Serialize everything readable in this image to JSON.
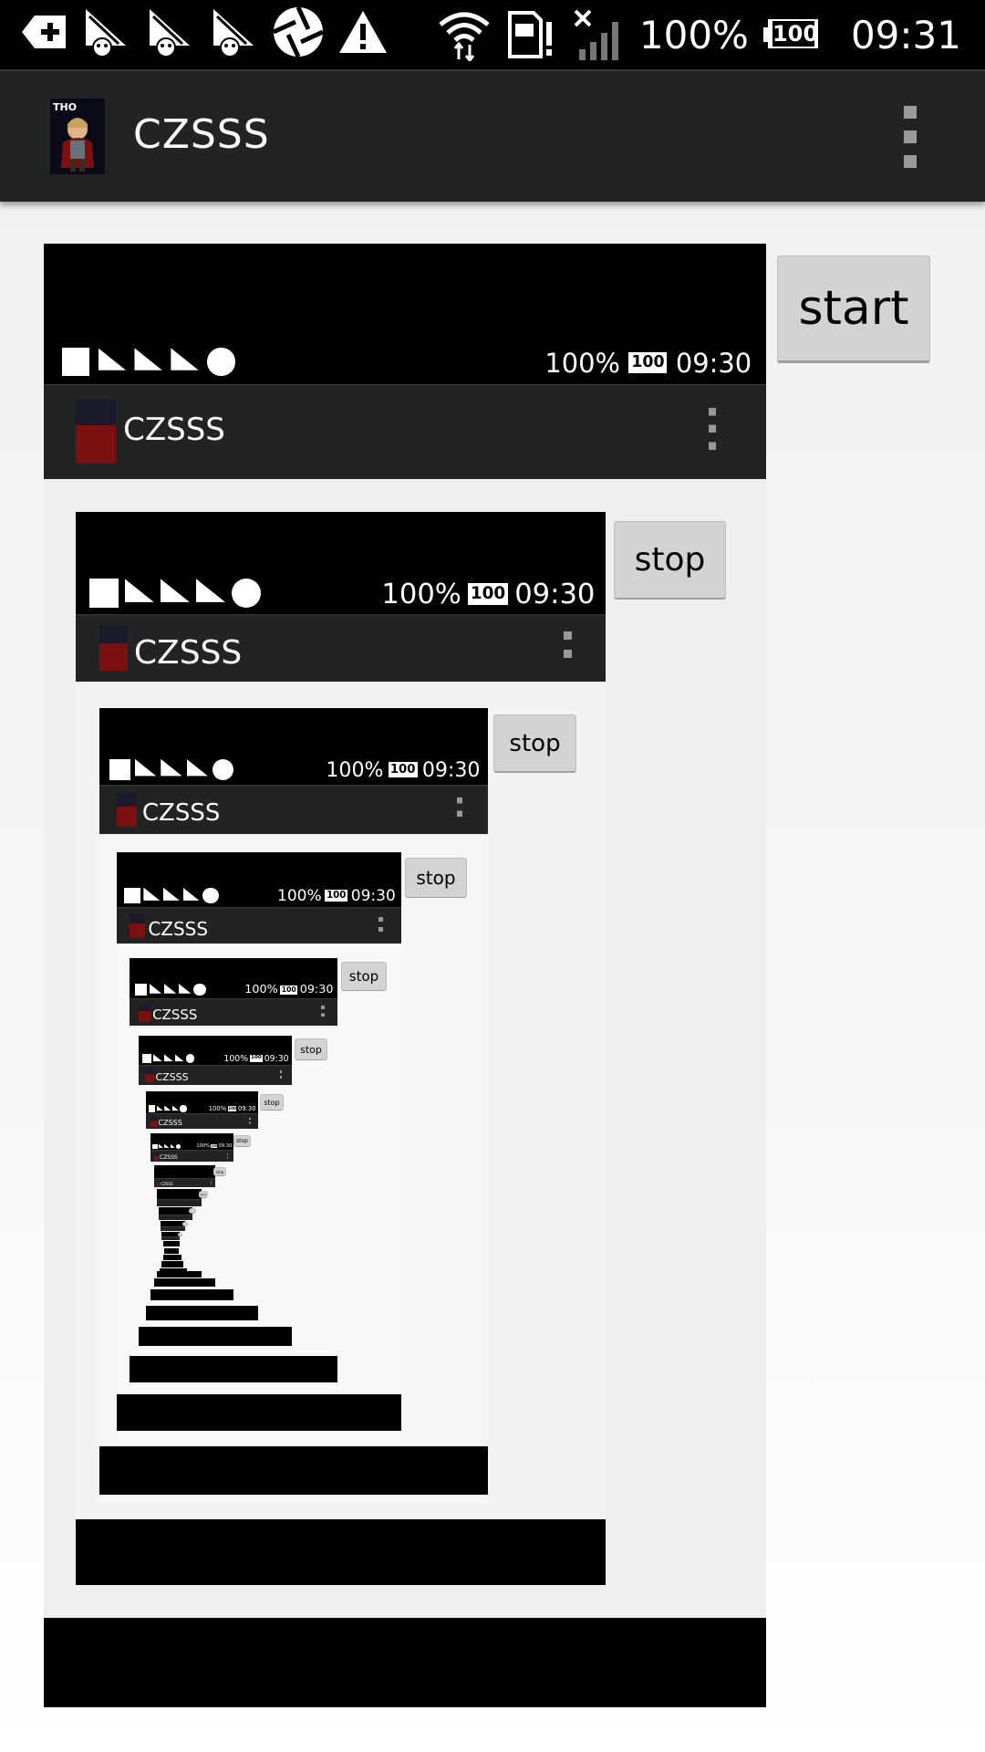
{
  "status_bar": {
    "battery_percent": "100%",
    "battery_level": "100",
    "time": "09:31",
    "icons": [
      "back-arrow-icon",
      "app-notification-icon",
      "app-notification-icon",
      "app-notification-icon",
      "shutter-icon",
      "warning-icon",
      "wifi-icon",
      "sim-alert-icon",
      "no-signal-icon",
      "battery-icon"
    ]
  },
  "action_bar": {
    "title": "CZSSS",
    "logo": "app-logo",
    "menu_icon": "overflow-menu-icon"
  },
  "main": {
    "start_label": "start"
  },
  "mirror": {
    "status_time": "09:30",
    "battery_percent": "100%",
    "battery_level": "100",
    "title": "CZSSS",
    "stop_label": "stop"
  },
  "colors": {
    "status_bar": "#000000",
    "action_bar": "#232323",
    "button": "#d3d3d3"
  }
}
